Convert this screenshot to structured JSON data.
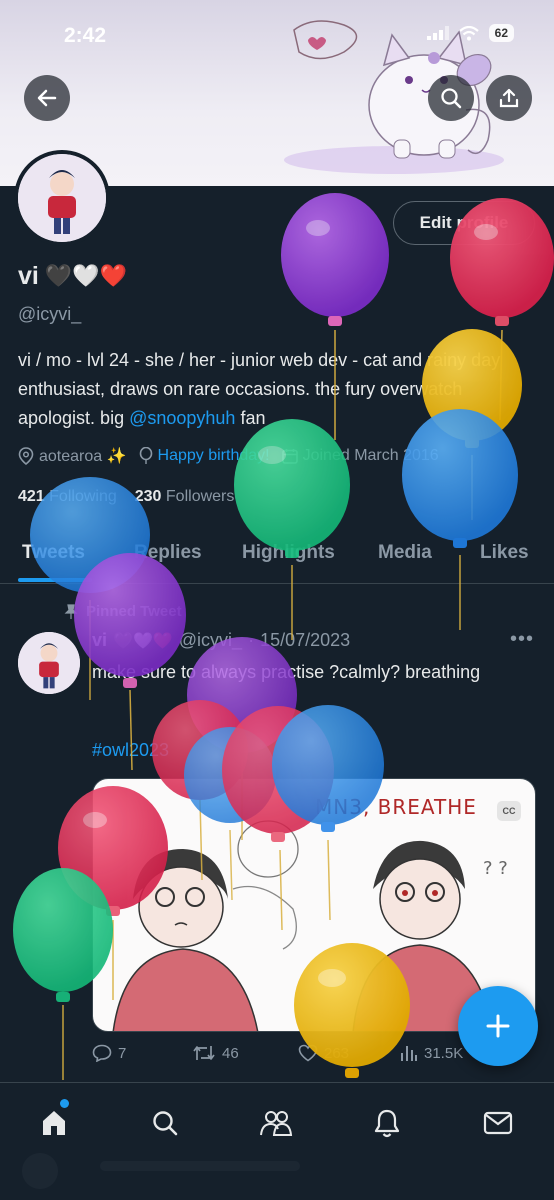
{
  "status_bar": {
    "time": "2:42",
    "battery": "62"
  },
  "profile": {
    "name": "vi",
    "name_emojis": "🖤🤍❤️",
    "handle": "@icyvi_",
    "edit_label": "Edit profile",
    "bio_text": "vi / mo - lvl 24 - she / her - junior web dev - cat and rainy day enthusiast, draws on rare occasions. the fury overwatch apologist. big ",
    "bio_mention": "@snoopyhuh",
    "bio_suffix": " fan",
    "location": "aotearoa ✨",
    "birthday": "Happy birthday!",
    "joined": "Joined March 2016",
    "following_count": "421",
    "following_label": "Following",
    "followers_count": "230",
    "followers_label": "Followers"
  },
  "tabs": [
    "Tweets",
    "Replies",
    "Highlights",
    "Media",
    "Likes"
  ],
  "tweet": {
    "pinned_label": "Pinned Tweet",
    "name": "vi",
    "name_emojis": "🖤🤍❤️",
    "handle": "@icyvi_",
    "date": "15/07/2023",
    "text": "make sure to always practise ?calmly? breathing",
    "hashtag": "#owl2023",
    "image_caption": "MN3, BREATHE",
    "cc_label": "CC",
    "replies": "7",
    "retweets": "46",
    "likes": "263",
    "views": "31.5K"
  },
  "icons": {
    "back": "back-arrow-icon",
    "search": "search-icon",
    "share": "share-icon",
    "location": "location-pin-icon",
    "birthday": "balloon-icon",
    "calendar": "calendar-icon"
  },
  "colors": {
    "background": "#15202b",
    "accent": "#1d9bf0",
    "text_primary": "#e7e9ea",
    "text_secondary": "#8b98a5"
  }
}
